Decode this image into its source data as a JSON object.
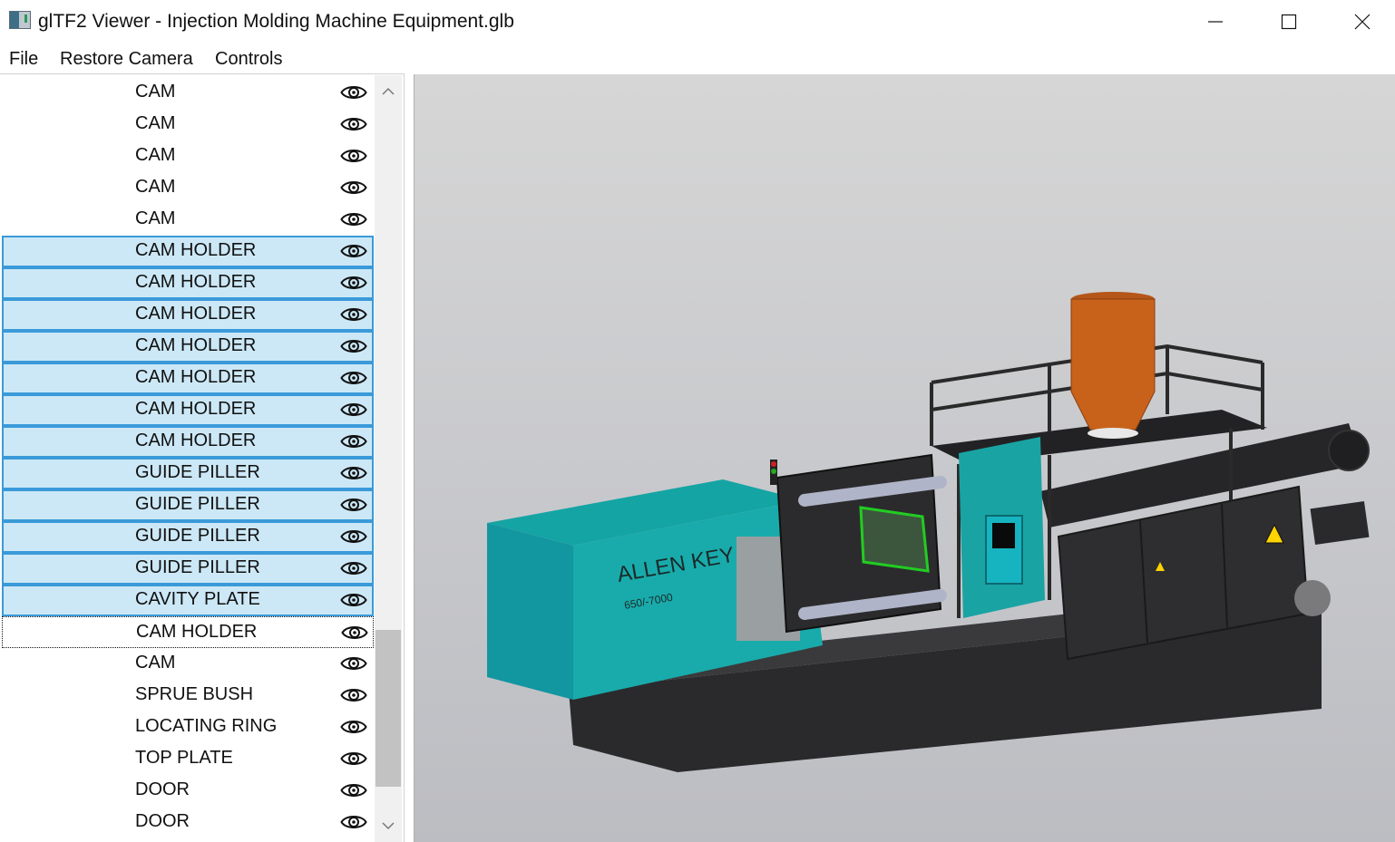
{
  "window": {
    "title": "glTF2 Viewer - Injection Molding Machine Equipment.glb"
  },
  "menu": {
    "file": "File",
    "restore_camera": "Restore Camera",
    "controls": "Controls"
  },
  "tree": {
    "items": [
      {
        "label": "CAM",
        "state": "normal"
      },
      {
        "label": "CAM",
        "state": "normal"
      },
      {
        "label": "CAM",
        "state": "normal"
      },
      {
        "label": "CAM",
        "state": "normal"
      },
      {
        "label": "CAM",
        "state": "normal"
      },
      {
        "label": "CAM HOLDER",
        "state": "selected"
      },
      {
        "label": "CAM HOLDER",
        "state": "selected"
      },
      {
        "label": "CAM HOLDER",
        "state": "selected"
      },
      {
        "label": "CAM HOLDER",
        "state": "selected"
      },
      {
        "label": "CAM HOLDER",
        "state": "selected"
      },
      {
        "label": "CAM HOLDER",
        "state": "selected"
      },
      {
        "label": "CAM HOLDER",
        "state": "selected"
      },
      {
        "label": "GUIDE PILLER",
        "state": "selected"
      },
      {
        "label": "GUIDE PILLER",
        "state": "selected"
      },
      {
        "label": "GUIDE PILLER",
        "state": "selected"
      },
      {
        "label": "GUIDE PILLER",
        "state": "selected"
      },
      {
        "label": "CAVITY PLATE",
        "state": "selected"
      },
      {
        "label": "CAM HOLDER",
        "state": "focused"
      },
      {
        "label": "CAM",
        "state": "normal"
      },
      {
        "label": "SPRUE BUSH",
        "state": "normal"
      },
      {
        "label": "LOCATING RING",
        "state": "normal"
      },
      {
        "label": "TOP PLATE",
        "state": "normal"
      },
      {
        "label": "DOOR",
        "state": "normal"
      },
      {
        "label": "DOOR",
        "state": "normal"
      }
    ],
    "visibility_icon": "eye-icon"
  },
  "viewport": {
    "machine_brand": "ALLEN KEY",
    "machine_model": "650/-7000",
    "colors": {
      "body_teal": "#1aa3a3",
      "frame_dark": "#2e2e30",
      "hopper_orange": "#c8621a",
      "selection_green": "#22cc22"
    }
  }
}
